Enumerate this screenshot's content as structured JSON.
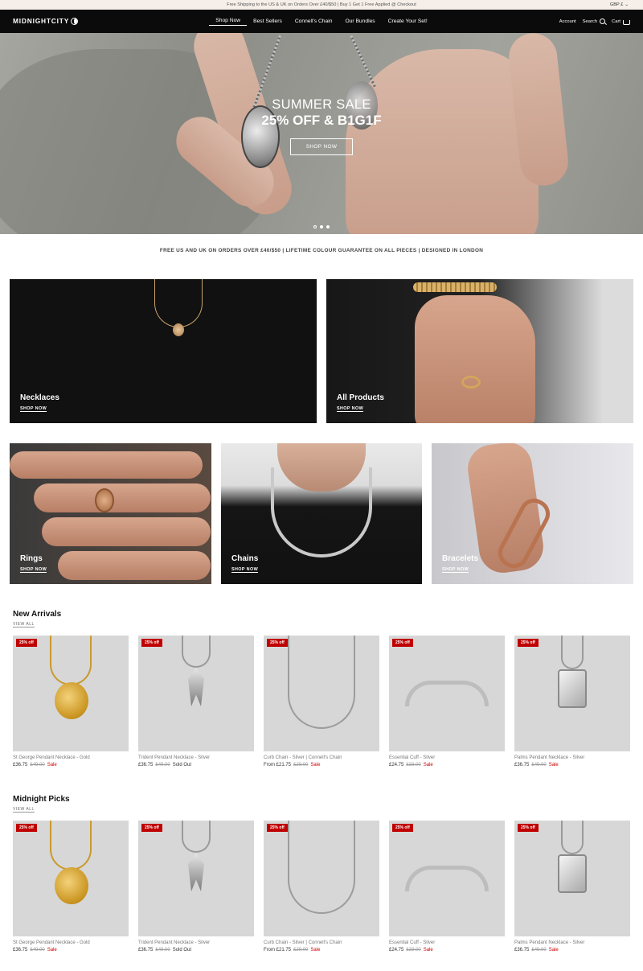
{
  "announcement": "Free Shipping to the US & UK on Orders Over £40/$50 | Buy 1 Get 1 Free Applied @ Checkout",
  "currency": "GBP £",
  "brand": "MIDNIGHTCITY",
  "nav": {
    "links": [
      "Shop Now",
      "Best Sellers",
      "Connell's Chain",
      "Our Bundles",
      "Create Your Set!"
    ],
    "account": "Account",
    "search": "Search",
    "cart": "Cart"
  },
  "hero": {
    "line1": "SUMMER SALE",
    "line2": "25% OFF & B1G1F",
    "button": "SHOP NOW",
    "slides": 3,
    "active_slide": 2
  },
  "usp": "FREE US AND UK ON ORDERS OVER £40/$50 | LIFETIME COLOUR GUARANTEE ON ALL PIECES | DESIGNED IN LONDON",
  "collections": [
    {
      "label": "Necklaces",
      "cta": "SHOP NOW"
    },
    {
      "label": "All Products",
      "cta": "SHOP NOW"
    },
    {
      "label": "Rings",
      "cta": "SHOP NOW"
    },
    {
      "label": "Chains",
      "cta": "SHOP NOW"
    },
    {
      "label": "Bracelets",
      "cta": "SHOP NOW"
    }
  ],
  "sections": [
    {
      "title": "New Arrivals",
      "view_all": "VIEW ALL",
      "products": [
        {
          "badge": "25% off",
          "name": "St George Pendant Necklace - Gold",
          "price": "£36.75",
          "was": "£49.00",
          "status": "Sale"
        },
        {
          "badge": "25% off",
          "name": "Trident Pendant Necklace - Silver",
          "price": "£36.75",
          "was": "£49.00",
          "status": "Sold Out"
        },
        {
          "badge": "25% off",
          "name": "Curb Chain - Silver | Connell's Chain",
          "price": "From £21.75",
          "was": "£29.00",
          "status": "Sale"
        },
        {
          "badge": "25% off",
          "name": "Essential Cuff - Silver",
          "price": "£24.75",
          "was": "£33.00",
          "status": "Sale"
        },
        {
          "badge": "25% off",
          "name": "Palms Pendant Necklace - Silver",
          "price": "£36.75",
          "was": "£49.00",
          "status": "Sale"
        }
      ]
    },
    {
      "title": "Midnight Picks",
      "view_all": "VIEW ALL",
      "products": [
        {
          "badge": "25% off",
          "name": "St George Pendant Necklace - Gold",
          "price": "£36.75",
          "was": "£49.00",
          "status": "Sale"
        },
        {
          "badge": "25% off",
          "name": "Trident Pendant Necklace - Silver",
          "price": "£36.75",
          "was": "£49.00",
          "status": "Sold Out"
        },
        {
          "badge": "25% off",
          "name": "Curb Chain - Silver | Connell's Chain",
          "price": "From £21.75",
          "was": "£29.00",
          "status": "Sale"
        },
        {
          "badge": "25% off",
          "name": "Essential Cuff - Silver",
          "price": "£24.75",
          "was": "£33.00",
          "status": "Sale"
        },
        {
          "badge": "25% off",
          "name": "Palms Pendant Necklace - Silver",
          "price": "£36.75",
          "was": "£49.00",
          "status": "Sale"
        }
      ]
    }
  ],
  "colors": {
    "announce_bg": "#f6efe9",
    "nav_bg": "#0b0b0b",
    "sale": "#c00000"
  }
}
